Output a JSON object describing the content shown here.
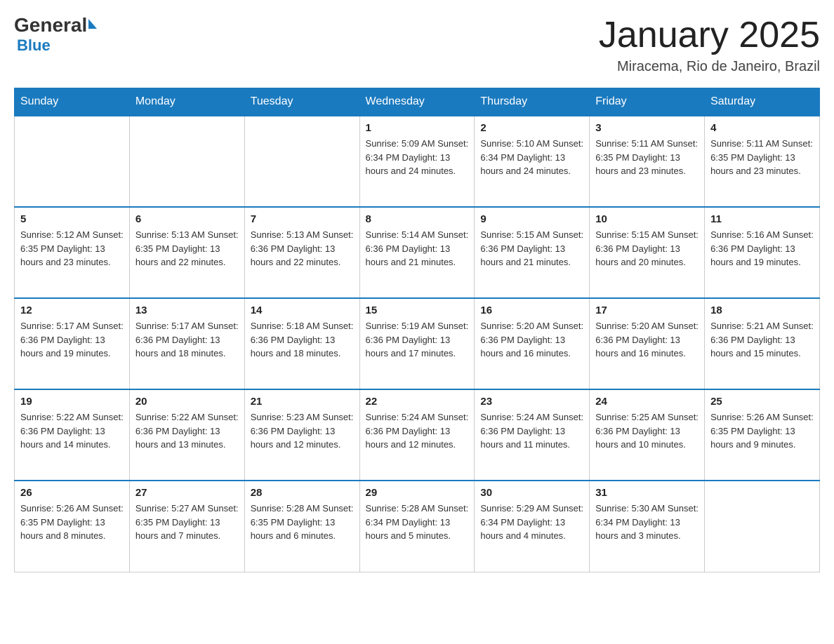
{
  "header": {
    "logo_general": "General",
    "logo_blue": "Blue",
    "month_title": "January 2025",
    "location": "Miracema, Rio de Janeiro, Brazil"
  },
  "days_of_week": [
    "Sunday",
    "Monday",
    "Tuesday",
    "Wednesday",
    "Thursday",
    "Friday",
    "Saturday"
  ],
  "weeks": [
    [
      {
        "day": "",
        "info": ""
      },
      {
        "day": "",
        "info": ""
      },
      {
        "day": "",
        "info": ""
      },
      {
        "day": "1",
        "info": "Sunrise: 5:09 AM\nSunset: 6:34 PM\nDaylight: 13 hours and 24 minutes."
      },
      {
        "day": "2",
        "info": "Sunrise: 5:10 AM\nSunset: 6:34 PM\nDaylight: 13 hours and 24 minutes."
      },
      {
        "day": "3",
        "info": "Sunrise: 5:11 AM\nSunset: 6:35 PM\nDaylight: 13 hours and 23 minutes."
      },
      {
        "day": "4",
        "info": "Sunrise: 5:11 AM\nSunset: 6:35 PM\nDaylight: 13 hours and 23 minutes."
      }
    ],
    [
      {
        "day": "5",
        "info": "Sunrise: 5:12 AM\nSunset: 6:35 PM\nDaylight: 13 hours and 23 minutes."
      },
      {
        "day": "6",
        "info": "Sunrise: 5:13 AM\nSunset: 6:35 PM\nDaylight: 13 hours and 22 minutes."
      },
      {
        "day": "7",
        "info": "Sunrise: 5:13 AM\nSunset: 6:36 PM\nDaylight: 13 hours and 22 minutes."
      },
      {
        "day": "8",
        "info": "Sunrise: 5:14 AM\nSunset: 6:36 PM\nDaylight: 13 hours and 21 minutes."
      },
      {
        "day": "9",
        "info": "Sunrise: 5:15 AM\nSunset: 6:36 PM\nDaylight: 13 hours and 21 minutes."
      },
      {
        "day": "10",
        "info": "Sunrise: 5:15 AM\nSunset: 6:36 PM\nDaylight: 13 hours and 20 minutes."
      },
      {
        "day": "11",
        "info": "Sunrise: 5:16 AM\nSunset: 6:36 PM\nDaylight: 13 hours and 19 minutes."
      }
    ],
    [
      {
        "day": "12",
        "info": "Sunrise: 5:17 AM\nSunset: 6:36 PM\nDaylight: 13 hours and 19 minutes."
      },
      {
        "day": "13",
        "info": "Sunrise: 5:17 AM\nSunset: 6:36 PM\nDaylight: 13 hours and 18 minutes."
      },
      {
        "day": "14",
        "info": "Sunrise: 5:18 AM\nSunset: 6:36 PM\nDaylight: 13 hours and 18 minutes."
      },
      {
        "day": "15",
        "info": "Sunrise: 5:19 AM\nSunset: 6:36 PM\nDaylight: 13 hours and 17 minutes."
      },
      {
        "day": "16",
        "info": "Sunrise: 5:20 AM\nSunset: 6:36 PM\nDaylight: 13 hours and 16 minutes."
      },
      {
        "day": "17",
        "info": "Sunrise: 5:20 AM\nSunset: 6:36 PM\nDaylight: 13 hours and 16 minutes."
      },
      {
        "day": "18",
        "info": "Sunrise: 5:21 AM\nSunset: 6:36 PM\nDaylight: 13 hours and 15 minutes."
      }
    ],
    [
      {
        "day": "19",
        "info": "Sunrise: 5:22 AM\nSunset: 6:36 PM\nDaylight: 13 hours and 14 minutes."
      },
      {
        "day": "20",
        "info": "Sunrise: 5:22 AM\nSunset: 6:36 PM\nDaylight: 13 hours and 13 minutes."
      },
      {
        "day": "21",
        "info": "Sunrise: 5:23 AM\nSunset: 6:36 PM\nDaylight: 13 hours and 12 minutes."
      },
      {
        "day": "22",
        "info": "Sunrise: 5:24 AM\nSunset: 6:36 PM\nDaylight: 13 hours and 12 minutes."
      },
      {
        "day": "23",
        "info": "Sunrise: 5:24 AM\nSunset: 6:36 PM\nDaylight: 13 hours and 11 minutes."
      },
      {
        "day": "24",
        "info": "Sunrise: 5:25 AM\nSunset: 6:36 PM\nDaylight: 13 hours and 10 minutes."
      },
      {
        "day": "25",
        "info": "Sunrise: 5:26 AM\nSunset: 6:35 PM\nDaylight: 13 hours and 9 minutes."
      }
    ],
    [
      {
        "day": "26",
        "info": "Sunrise: 5:26 AM\nSunset: 6:35 PM\nDaylight: 13 hours and 8 minutes."
      },
      {
        "day": "27",
        "info": "Sunrise: 5:27 AM\nSunset: 6:35 PM\nDaylight: 13 hours and 7 minutes."
      },
      {
        "day": "28",
        "info": "Sunrise: 5:28 AM\nSunset: 6:35 PM\nDaylight: 13 hours and 6 minutes."
      },
      {
        "day": "29",
        "info": "Sunrise: 5:28 AM\nSunset: 6:34 PM\nDaylight: 13 hours and 5 minutes."
      },
      {
        "day": "30",
        "info": "Sunrise: 5:29 AM\nSunset: 6:34 PM\nDaylight: 13 hours and 4 minutes."
      },
      {
        "day": "31",
        "info": "Sunrise: 5:30 AM\nSunset: 6:34 PM\nDaylight: 13 hours and 3 minutes."
      },
      {
        "day": "",
        "info": ""
      }
    ]
  ]
}
